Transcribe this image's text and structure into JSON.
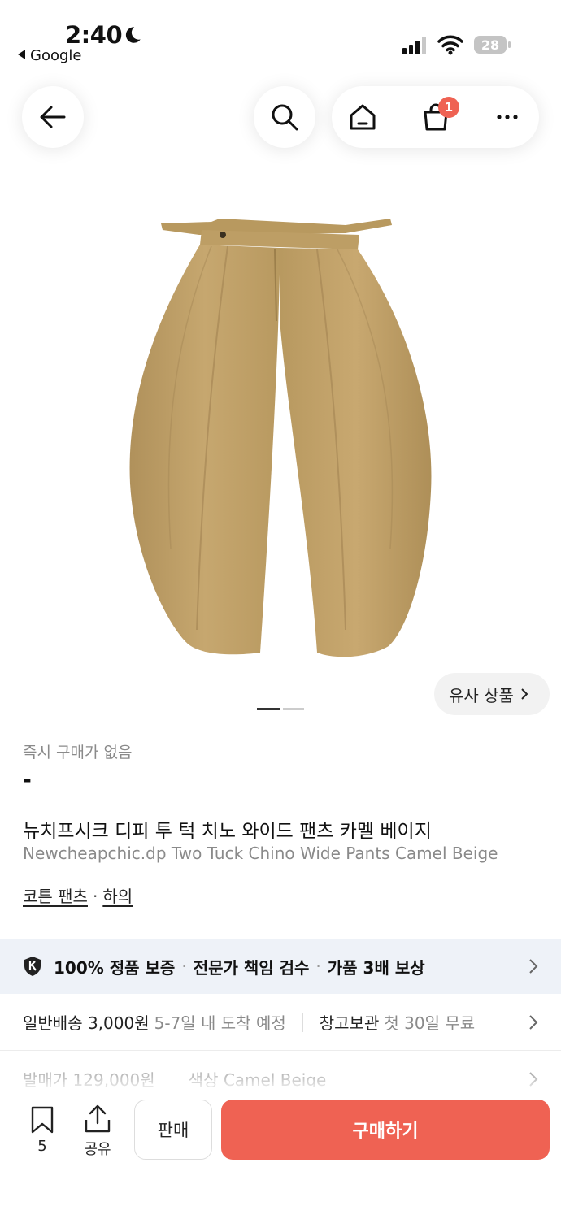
{
  "status_bar": {
    "time": "2:40",
    "back_app": "Google",
    "battery": "28"
  },
  "nav": {
    "cart_badge": "1"
  },
  "gallery": {
    "similar_label": "유사 상품"
  },
  "product": {
    "no_instant_buy": "즉시 구매가 없음",
    "price": "-",
    "name_ko": "뉴치프시크 디피 투 턱 치노 와이드 팬츠 카멜 베이지",
    "name_en": "Newcheapchic.dp Two Tuck Chino Wide Pants Camel Beige",
    "categories": [
      "코튼 팬츠",
      "하의"
    ],
    "category_separator": "·"
  },
  "guarantee": {
    "items": [
      "100% 정품 보증",
      "전문가 책임 검수",
      "가품 3배 보상"
    ],
    "separator": "·"
  },
  "shipping": {
    "label": "일반배송 3,000원",
    "eta": "5-7일 내 도착 예정",
    "storage_label": "창고보관",
    "storage_note": "첫 30일 무료"
  },
  "details": {
    "release_price_label": "발매가 129,000원",
    "color_label": "색상 Camel Beige"
  },
  "bottom_bar": {
    "bookmark_count": "5",
    "share_label": "공유",
    "sell_label": "판매",
    "buy_label": "구매하기"
  },
  "colors": {
    "accent": "#ef6253",
    "guarantee_bg": "#eef2f8",
    "product": "#c1a26a"
  }
}
